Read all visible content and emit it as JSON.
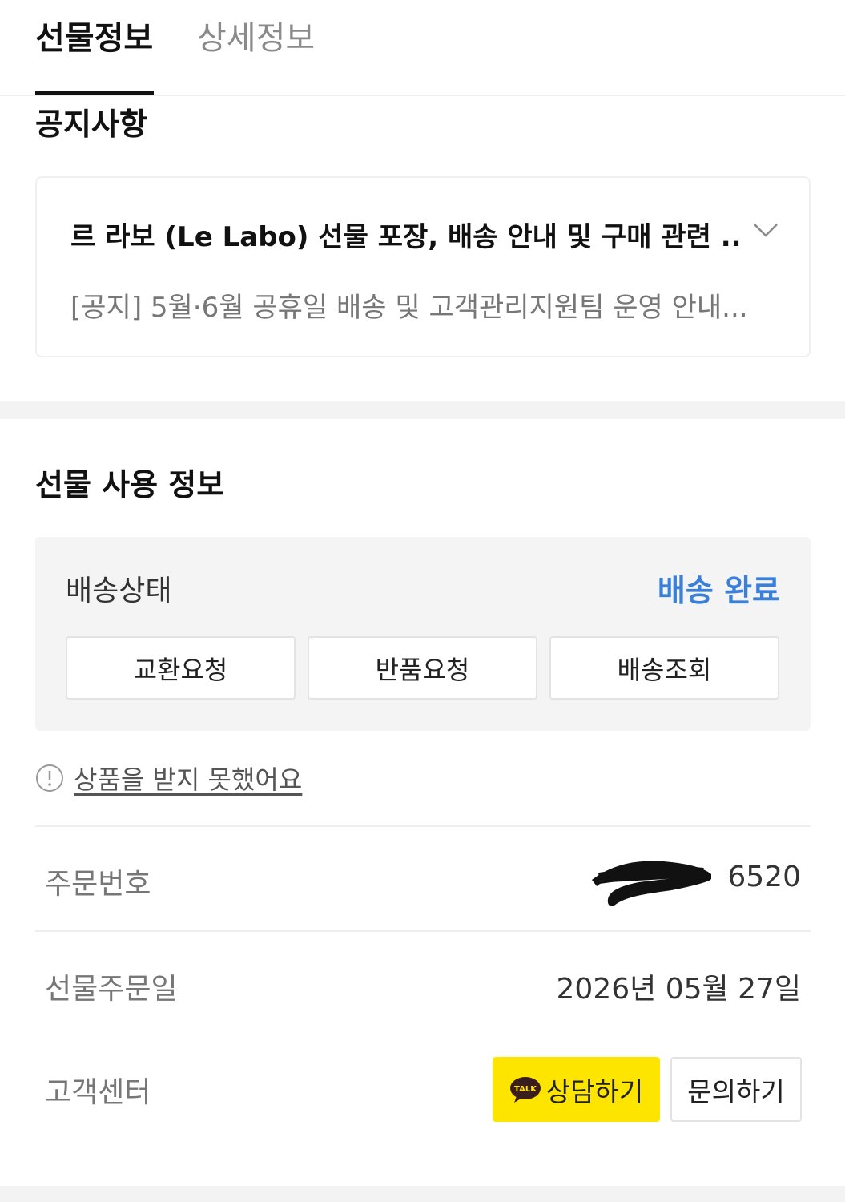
{
  "tabs": [
    {
      "label": "선물정보",
      "active": true
    },
    {
      "label": "상세정보",
      "active": false
    }
  ],
  "notice": {
    "title": "공지사항",
    "items": [
      "르 라보 (Le Labo) 선물 포장, 배송 안내 및 구매 관련 ...",
      "[공지] 5월·6월 공휴일 배송 및 고객관리지원팀 운영 안내..."
    ],
    "expand_icon": "chevron-down-icon"
  },
  "usage": {
    "title": "선물 사용 정보",
    "status_label": "배송상태",
    "status_value": "배송 완료",
    "status_color": "#3a7fd8",
    "buttons": [
      "교환요청",
      "반품요청",
      "배송조회"
    ],
    "not_received": "상품을 받지 못했어요",
    "info_icon": "info-circle-icon"
  },
  "order": {
    "number_label": "주문번호",
    "number_value": "6520",
    "date_label": "선물주문일",
    "date_value": "2026년 05월 27일",
    "support_label": "고객센터",
    "talk_button": "상담하기",
    "talk_icon_text": "TALK",
    "inquiry_button": "문의하기",
    "talk_color": "#fee500"
  }
}
